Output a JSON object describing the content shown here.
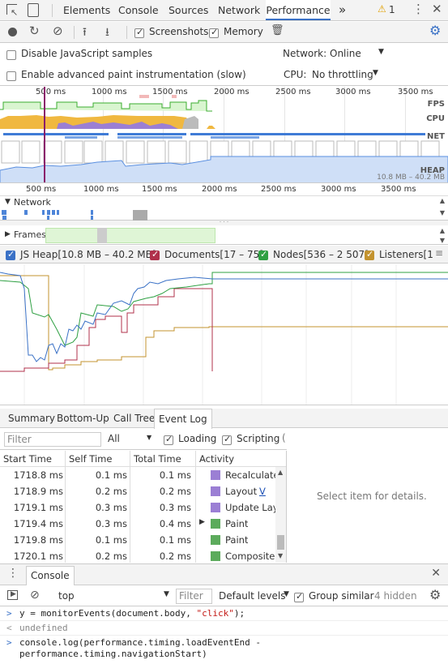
{
  "toolbar": {
    "tabs": [
      "Elements",
      "Console",
      "Sources",
      "Network",
      "Performance"
    ],
    "more": "»",
    "warning_count": "1"
  },
  "controls": {
    "screenshots_label": "Screenshots",
    "memory_label": "Memory"
  },
  "settings": {
    "disable_js_label": "Disable JavaScript samples",
    "paint_label": "Enable advanced paint instrumentation (slow)",
    "network_label": "Network:",
    "network_value": "Online",
    "cpu_label": "CPU:",
    "cpu_value": "No throttling"
  },
  "overview": {
    "ticks": [
      "500 ms",
      "1000 ms",
      "1500 ms",
      "2000 ms",
      "2500 ms",
      "3000 ms",
      "3500 ms"
    ],
    "fps": "FPS",
    "cpu": "CPU",
    "net": "NET",
    "heap": "HEAP",
    "heap_range": "10.8 MB – 40.2 MB"
  },
  "flamechart": {
    "ticks": [
      "500 ms",
      "1000 ms",
      "1500 ms",
      "2000 ms",
      "2500 ms",
      "3000 ms",
      "3500 ms"
    ],
    "network_track": "Network",
    "frames_track": "Frames"
  },
  "counters": {
    "js_heap": "JS Heap[10.8 MB – 40.2 MB]",
    "documents": "Documents[17 – 75]",
    "nodes": "Nodes[536 – 2 507]",
    "listeners": "Listeners[1",
    "colors": {
      "js_heap": "#3a71c6",
      "documents": "#b0304b",
      "nodes": "#2fa043",
      "listeners": "#c3932f"
    }
  },
  "bottom_tabs": [
    "Summary",
    "Bottom-Up",
    "Call Tree",
    "Event Log"
  ],
  "filter": {
    "placeholder": "Filter",
    "all": "All",
    "loading": "Loading",
    "scripting": "Scripting"
  },
  "event_log": {
    "headers": [
      "Start Time",
      "Self Time",
      "Total Time",
      "Activity"
    ],
    "rows": [
      {
        "start": "1718.8 ms",
        "self": "0.1 ms",
        "total": "0.1 ms",
        "activity": "Recalculate",
        "color": "#9b7fd4",
        "expand": ""
      },
      {
        "start": "1718.9 ms",
        "self": "0.2 ms",
        "total": "0.2 ms",
        "activity": "Layout",
        "link": "V",
        "color": "#9b7fd4",
        "expand": ""
      },
      {
        "start": "1719.1 ms",
        "self": "0.3 ms",
        "total": "0.3 ms",
        "activity": "Update Lay",
        "color": "#9b7fd4",
        "expand": ""
      },
      {
        "start": "1719.4 ms",
        "self": "0.3 ms",
        "total": "0.4 ms",
        "activity": "Paint",
        "color": "#5cab5c",
        "expand": "▶"
      },
      {
        "start": "1719.8 ms",
        "self": "0.1 ms",
        "total": "0.1 ms",
        "activity": "Paint",
        "color": "#5cab5c",
        "expand": ""
      },
      {
        "start": "1720.1 ms",
        "self": "0.2 ms",
        "total": "0.2 ms",
        "activity": "Composite",
        "color": "#5cab5c",
        "expand": ""
      }
    ],
    "details_empty": "Select item for details."
  },
  "drawer": {
    "tab": "Console",
    "context": "top",
    "filter_placeholder": "Filter",
    "levels": "Default levels",
    "group_similar": "Group similar",
    "hidden": "4 hidden",
    "lines": [
      {
        "prompt": ">",
        "code": "y = monitorEvents(document.body, ",
        "str": "\"click\"",
        "end": ");"
      },
      {
        "prompt": "<",
        "result": "undefined"
      },
      {
        "prompt": ">",
        "code": "console.log(performance.timing.loadEventEnd -",
        "code2": "performance.timing.navigationStart)"
      }
    ]
  }
}
